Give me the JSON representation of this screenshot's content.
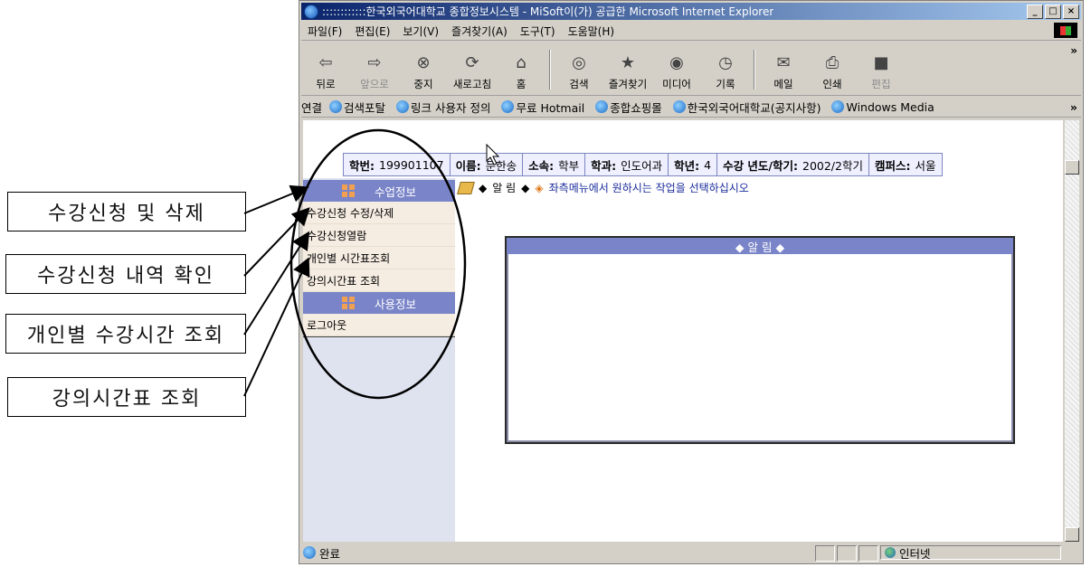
{
  "callouts": [
    "수강신청 및 삭제",
    "수강신청 내역 확인",
    "개인별 수강시간 조회",
    "강의시간표 조회"
  ],
  "window": {
    "title": "::::::::::::한국외국어대학교 종합정보시스템 - MiSoft이(가) 공급한 Microsoft Internet Explorer",
    "buttons": [
      "_",
      "□",
      "×"
    ]
  },
  "menubar": [
    "파일(F)",
    "편집(E)",
    "보기(V)",
    "즐겨찾기(A)",
    "도구(T)",
    "도움말(H)"
  ],
  "toolbar": [
    {
      "label": "뒤로",
      "icon": "back-arrow-icon",
      "glyph": "⇦"
    },
    {
      "label": "앞으로",
      "icon": "forward-arrow-icon",
      "glyph": "⇨",
      "disabled": true
    },
    {
      "label": "중지",
      "icon": "stop-icon",
      "glyph": "⊗"
    },
    {
      "label": "새로고침",
      "icon": "refresh-icon",
      "glyph": "⟳"
    },
    {
      "label": "홈",
      "icon": "home-icon",
      "glyph": "⌂"
    },
    {
      "label": "검색",
      "icon": "search-icon",
      "glyph": "◎"
    },
    {
      "label": "즐겨찾기",
      "icon": "favorites-icon",
      "glyph": "★"
    },
    {
      "label": "미디어",
      "icon": "media-icon",
      "glyph": "◉"
    },
    {
      "label": "기록",
      "icon": "history-icon",
      "glyph": "◷"
    },
    {
      "label": "메일",
      "icon": "mail-icon",
      "glyph": "✉"
    },
    {
      "label": "인쇄",
      "icon": "print-icon",
      "glyph": "⎙"
    },
    {
      "label": "편집",
      "icon": "edit-icon",
      "glyph": "■",
      "disabled": true
    }
  ],
  "links": {
    "label": "연결",
    "items": [
      "검색포탈",
      "링크 사용자 정의",
      "무료 Hotmail",
      "종합쇼핑몰",
      "한국외국어대학교(공지사항)",
      "Windows Media"
    ]
  },
  "info": [
    {
      "key": "학번:",
      "value": "199901107"
    },
    {
      "key": "이름:",
      "value": "문한송"
    },
    {
      "key": "소속:",
      "value": "학부"
    },
    {
      "key": "학과:",
      "value": "인도어과"
    },
    {
      "key": "학년:",
      "value": "4"
    },
    {
      "key": "수강 년도/학기:",
      "value": "2002/2학기"
    },
    {
      "key": "캠퍼스:",
      "value": "서울"
    }
  ],
  "sidebar": {
    "section1": "수업정보",
    "items1": [
      "수강신청 수정/삭제",
      "수강신청열람",
      "개인별 시간표조회",
      "강의시간표 조회"
    ],
    "section2": "사용정보",
    "items2": [
      "로그아웃"
    ]
  },
  "notice": {
    "label": "알 림",
    "message": "좌측메뉴에서 원하시는 작업을 선택하십시오"
  },
  "alert": {
    "header": "◆ 알 림 ◆"
  },
  "status": {
    "left": "완료",
    "zone": "인터넷"
  }
}
